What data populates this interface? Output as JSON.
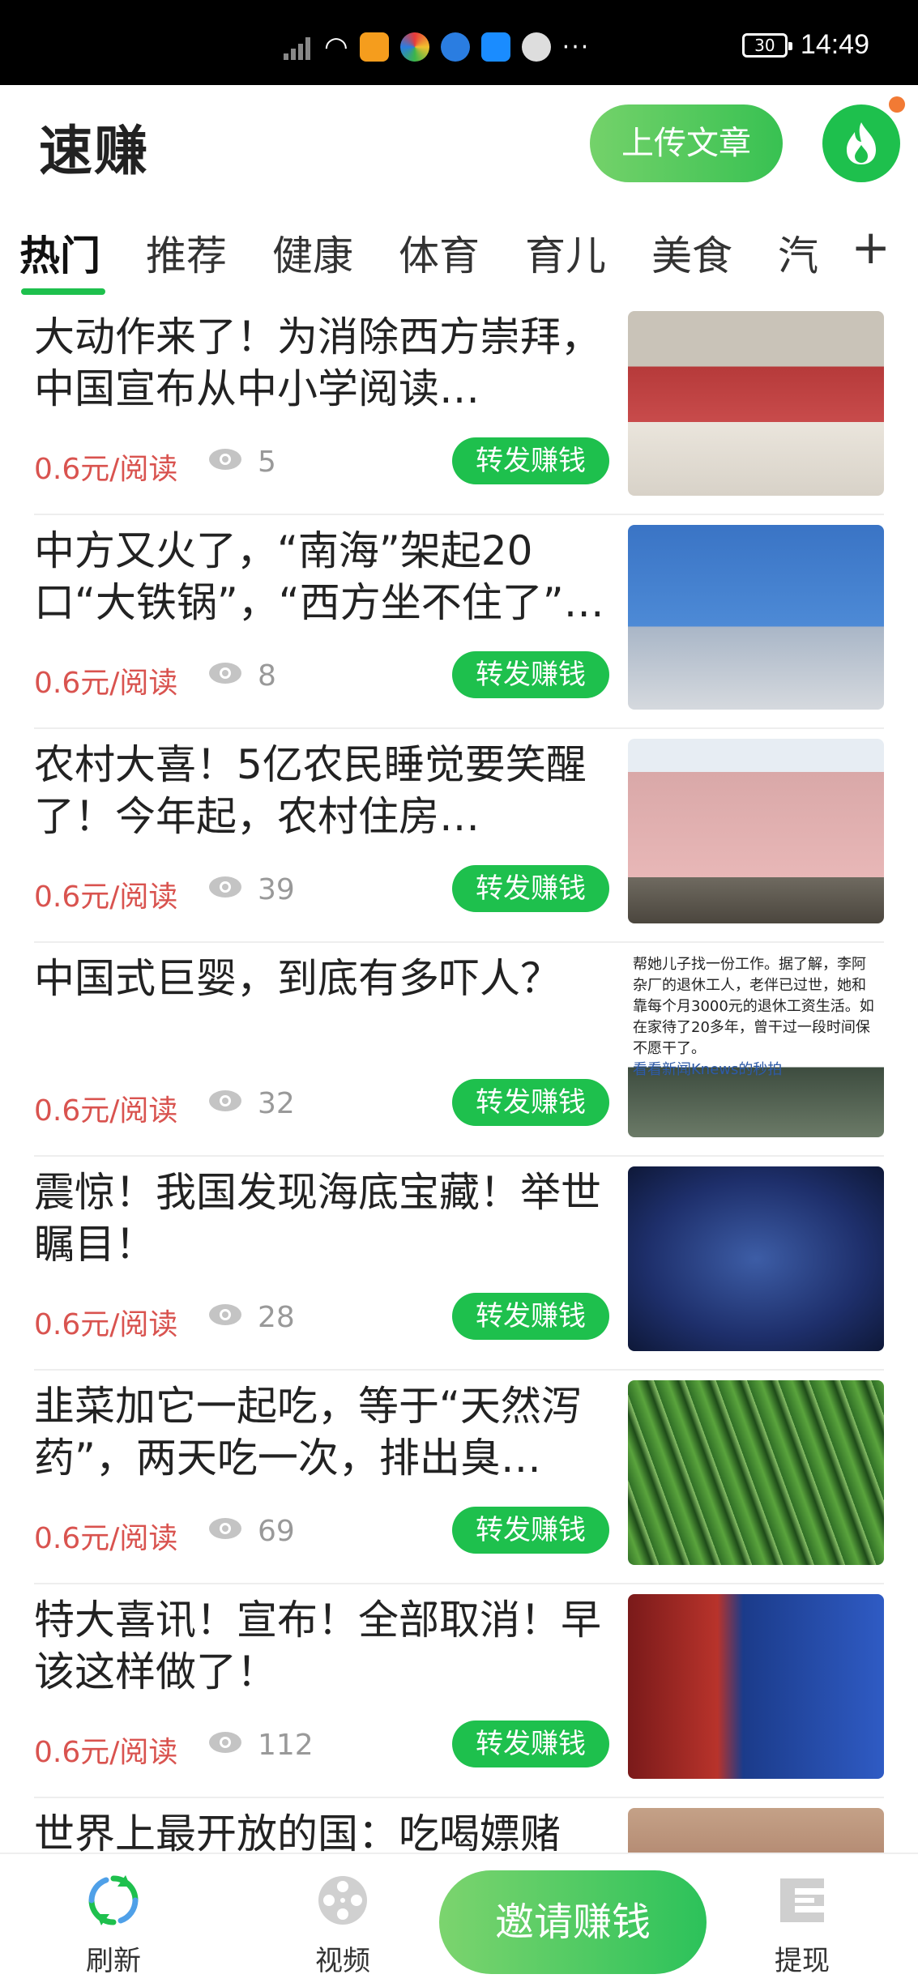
{
  "status_bar": {
    "time": "14:49",
    "battery": "30",
    "more": "···"
  },
  "header": {
    "app_title": "速赚",
    "upload_button": "上传文章",
    "accent": "#1ec04d"
  },
  "tabs": [
    {
      "label": "热门",
      "active": true
    },
    {
      "label": "推荐",
      "active": false
    },
    {
      "label": "健康",
      "active": false
    },
    {
      "label": "体育",
      "active": false
    },
    {
      "label": "育儿",
      "active": false
    },
    {
      "label": "美食",
      "active": false
    },
    {
      "label": "汽",
      "active": false
    }
  ],
  "tab_add": "+",
  "articles": [
    {
      "title": "大动作来了！为消除西方崇拜，中国宣布从中小学阅读…",
      "price": "0.6元/阅读",
      "views": "5",
      "share": "转发赚钱"
    },
    {
      "title": "中方又火了，“南海”架起20口“大铁锅”，“西方坐不住了”…",
      "price": "0.6元/阅读",
      "views": "8",
      "share": "转发赚钱"
    },
    {
      "title": "农村大喜！5亿农民睡觉要笑醒了！今年起，农村住房…",
      "price": "0.6元/阅读",
      "views": "39",
      "share": "转发赚钱"
    },
    {
      "title": "中国式巨婴，到底有多吓人？",
      "price": "0.6元/阅读",
      "views": "32",
      "share": "转发赚钱"
    },
    {
      "title": "震惊！我国发现海底宝藏！举世瞩目！",
      "price": "0.6元/阅读",
      "views": "28",
      "share": "转发赚钱"
    },
    {
      "title": "韭菜加它一起吃，等于“天然泻药”，两天吃一次，排出臭…",
      "price": "0.6元/阅读",
      "views": "69",
      "share": "转发赚钱"
    },
    {
      "title": "特大喜讯！宣布！全部取消！早该这样做了！",
      "price": "0.6元/阅读",
      "views": "112",
      "share": "转发赚钱"
    },
    {
      "title": "世界上最开放的国：吃喝嫖赌",
      "price": "",
      "views": "",
      "share": ""
    }
  ],
  "thumb4_text": [
    "帮她儿子找一份工作。据了解，李阿",
    "杂厂的退休工人，老伴已过世，她和",
    "靠每个月3000元的退休工资生活。如",
    "在家待了20多年，曾干过一段时间保",
    "不愿干了。"
  ],
  "thumb4_link": "看看新闻Knews的秒拍",
  "bottom_nav": {
    "refresh": "刷新",
    "video": "视频",
    "invite": "邀请赚钱",
    "withdraw": "提现"
  }
}
